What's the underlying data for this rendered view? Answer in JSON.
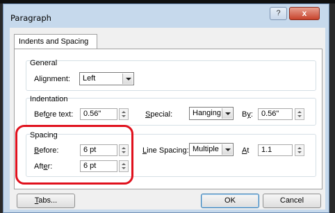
{
  "window": {
    "title": "Paragraph",
    "help_label": "?",
    "close_label": "x",
    "frame_color": "#c6d9ec",
    "highlight_color": "#e0101c"
  },
  "tab": {
    "label": "Indents and Spacing"
  },
  "general": {
    "group_label": "General",
    "alignment_label_pre": "Ali",
    "alignment_label_ul": "g",
    "alignment_label_post": "nment:",
    "alignment_value": "Left"
  },
  "indentation": {
    "group_label": "Indentation",
    "before_text_label_pre": "Bef",
    "before_text_label_ul": "o",
    "before_text_label_post": "re text:",
    "before_text_value": "0.56\"",
    "special_label_ul": "S",
    "special_label_post": "pecial:",
    "special_value": "Hanging",
    "by_label_pre": "B",
    "by_label_ul": "y",
    "by_label_post": ":",
    "by_value": "0.56\""
  },
  "spacing": {
    "group_label": "Spacing",
    "before_label_ul": "B",
    "before_label_post": "efore:",
    "before_value": "6 pt",
    "after_label_pre": "Aft",
    "after_label_ul": "e",
    "after_label_post": "r:",
    "after_value": "6 pt",
    "line_spacing_label_ul": "L",
    "line_spacing_label_post": "ine Spacing:",
    "line_spacing_value": "Multiple",
    "at_label_ul": "A",
    "at_label_post": "t",
    "at_value": "1.1"
  },
  "footer": {
    "tabs_button_ul": "T",
    "tabs_button_post": "abs...",
    "ok_label": "OK",
    "cancel_label": "Cancel"
  }
}
